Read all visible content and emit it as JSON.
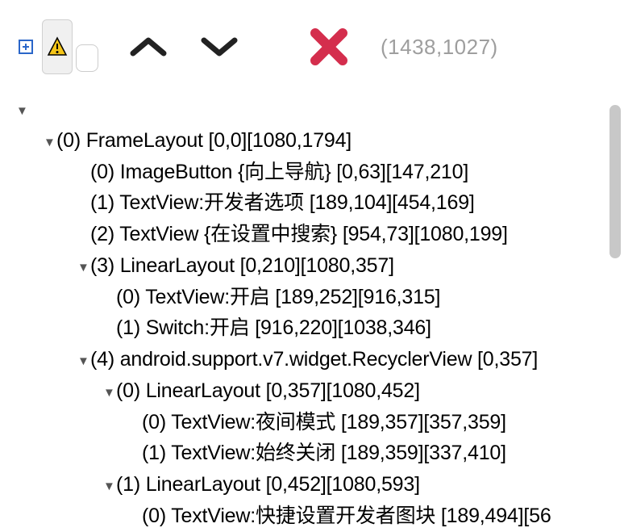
{
  "toolbar": {
    "coords": "(1438,1027)"
  },
  "tree": {
    "r0": "(0) FrameLayout [0,0][1080,1794]",
    "r1": "(0) ImageButton {向上导航} [0,63][147,210]",
    "r2": "(1) TextView:开发者选项 [189,104][454,169]",
    "r3": "(2) TextView {在设置中搜索} [954,73][1080,199]",
    "r4": "(3) LinearLayout [0,210][1080,357]",
    "r5": "(0) TextView:开启 [189,252][916,315]",
    "r6": "(1) Switch:开启 [916,220][1038,346]",
    "r7": "(4) android.support.v7.widget.RecyclerView [0,357]",
    "r8": "(0) LinearLayout [0,357][1080,452]",
    "r9": "(0) TextView:夜间模式 [189,357][357,359]",
    "r10": "(1) TextView:始终关闭 [189,359][337,410]",
    "r11": "(1) LinearLayout [0,452][1080,593]",
    "r12": "(0) TextView:快捷设置开发者图块 [189,494][56"
  }
}
